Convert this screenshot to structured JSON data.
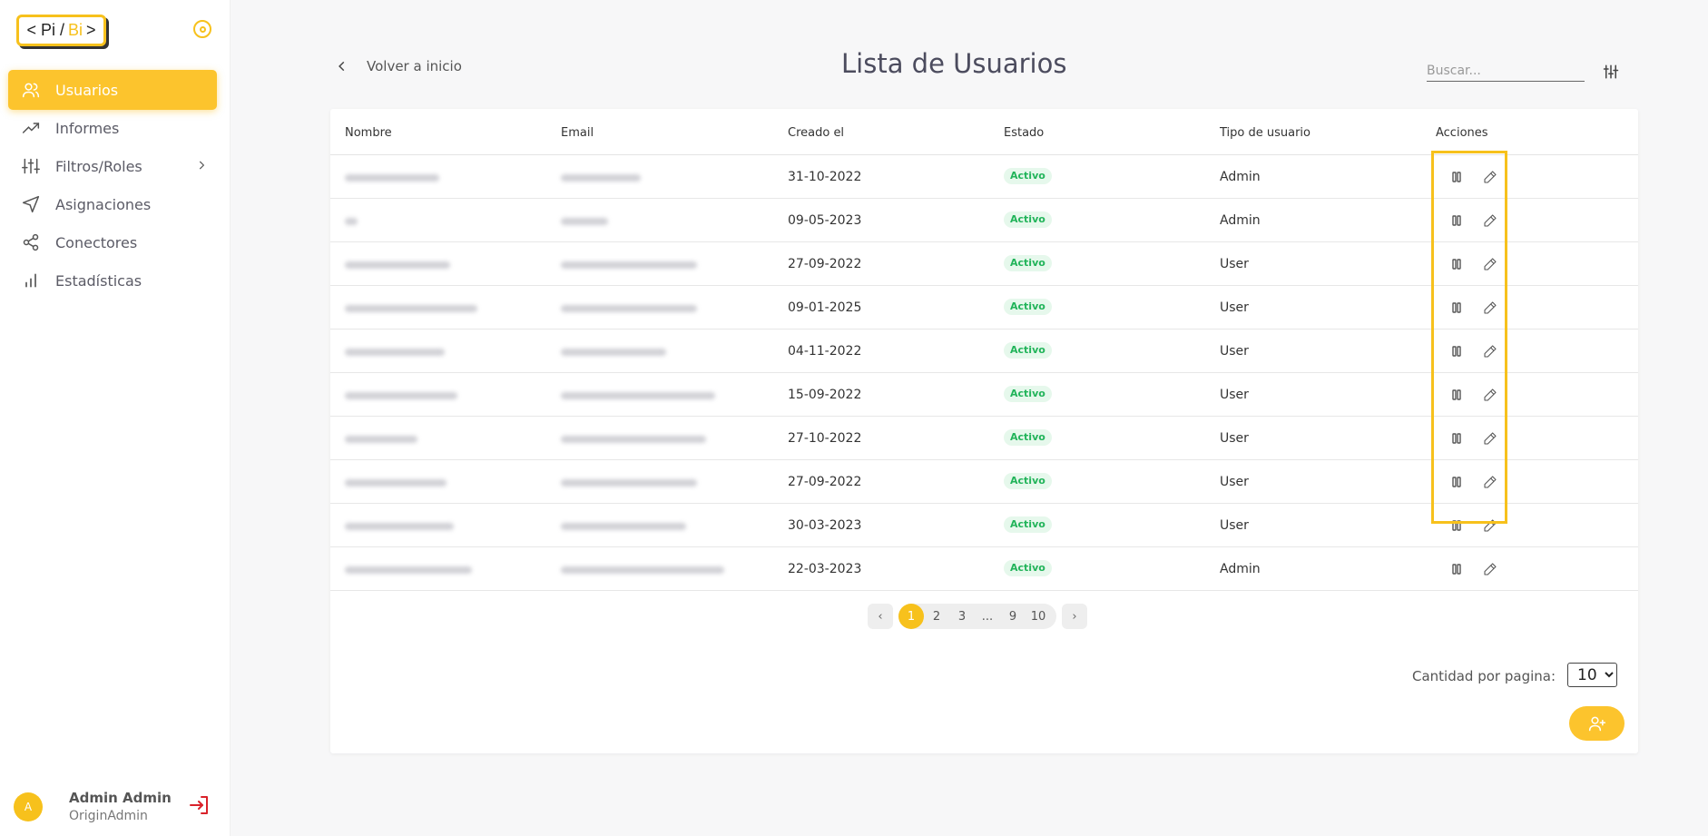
{
  "logo": {
    "left": "< Pi /",
    "bi": "Bi",
    "right": ">"
  },
  "colors": {
    "accent": "#fcc42d",
    "active_badge_bg": "#e6f8ec",
    "active_badge_text": "#22b45a",
    "logout": "#d9222a"
  },
  "sidebar": {
    "items": [
      {
        "label": "Usuarios",
        "icon": "users-icon",
        "active": true
      },
      {
        "label": "Informes",
        "icon": "trending-up-icon"
      },
      {
        "label": "Filtros/Roles",
        "icon": "sliders-icon",
        "has_submenu": true
      },
      {
        "label": "Asignaciones",
        "icon": "send-icon"
      },
      {
        "label": "Conectores",
        "icon": "share-icon"
      },
      {
        "label": "Estadísticas",
        "icon": "bar-chart-icon"
      }
    ]
  },
  "user": {
    "avatar_initial": "A",
    "name": "Admin Admin",
    "role": "OriginAdmin"
  },
  "header": {
    "back_label": "Volver a inicio",
    "title": "Lista de Usuarios",
    "search_placeholder": "Buscar..."
  },
  "table": {
    "columns": [
      "Nombre",
      "Email",
      "Creado el",
      "Estado",
      "Tipo de usuario",
      "Acciones"
    ],
    "rows": [
      {
        "created": "31-10-2022",
        "status": "Activo",
        "type": "Admin"
      },
      {
        "created": "09-05-2023",
        "status": "Activo",
        "type": "Admin"
      },
      {
        "created": "27-09-2022",
        "status": "Activo",
        "type": "User"
      },
      {
        "created": "09-01-2025",
        "status": "Activo",
        "type": "User"
      },
      {
        "created": "04-11-2022",
        "status": "Activo",
        "type": "User"
      },
      {
        "created": "15-09-2022",
        "status": "Activo",
        "type": "User"
      },
      {
        "created": "27-10-2022",
        "status": "Activo",
        "type": "User"
      },
      {
        "created": "27-09-2022",
        "status": "Activo",
        "type": "User"
      },
      {
        "created": "30-03-2023",
        "status": "Activo",
        "type": "User"
      },
      {
        "created": "22-03-2023",
        "status": "Activo",
        "type": "Admin"
      }
    ]
  },
  "pagination": {
    "prev": "‹",
    "next": "›",
    "pages": [
      "1",
      "2",
      "3",
      "...",
      "9",
      "10"
    ],
    "current": "1"
  },
  "per_page": {
    "label": "Cantidad por pagina:",
    "value": "10",
    "options": [
      "10"
    ]
  }
}
